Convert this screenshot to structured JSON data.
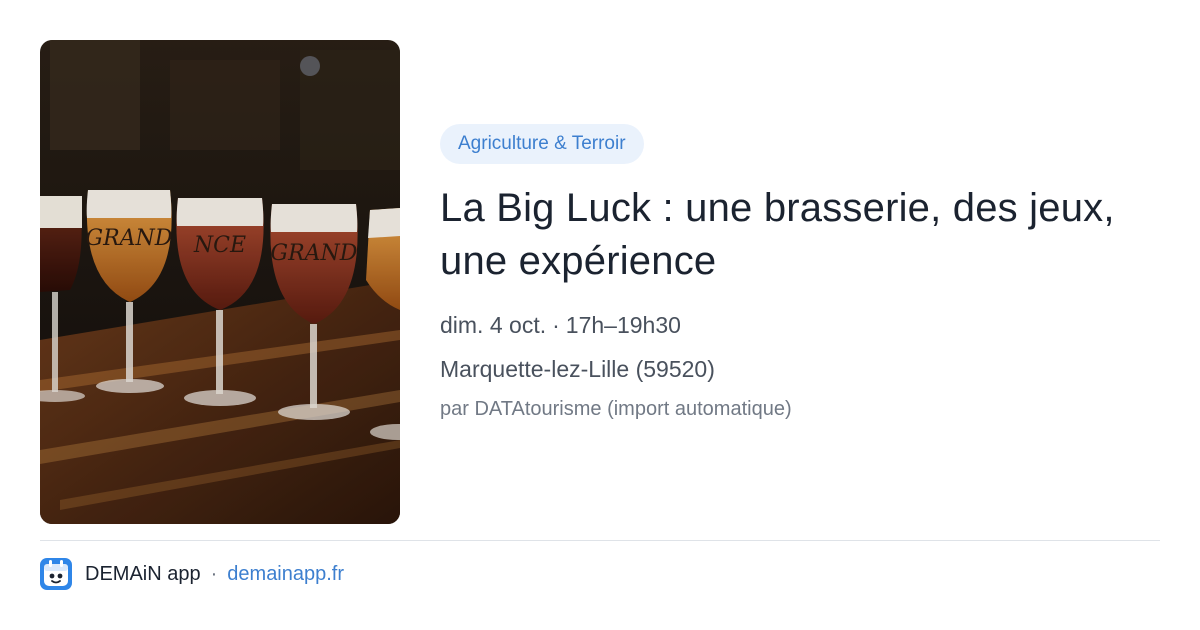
{
  "event": {
    "category": "Agriculture & Terroir",
    "title": "La Big Luck : une brasserie, des jeux, une expérience",
    "date": "dim. 4 oct.",
    "time": "17h–19h30",
    "location": "Marquette-lez-Lille (59520)",
    "source": "par DATAtourisme (import automatique)"
  },
  "image": {
    "glass_text": [
      "GRAND",
      "NCE",
      "GRAND"
    ]
  },
  "footer": {
    "app_name": "DEMAiN app",
    "separator": "·",
    "domain": "demainapp.fr"
  },
  "colors": {
    "accent": "#3d7fcf",
    "tag_background": "#eaf2fc",
    "title": "#1b2330",
    "text": "#49515d"
  }
}
